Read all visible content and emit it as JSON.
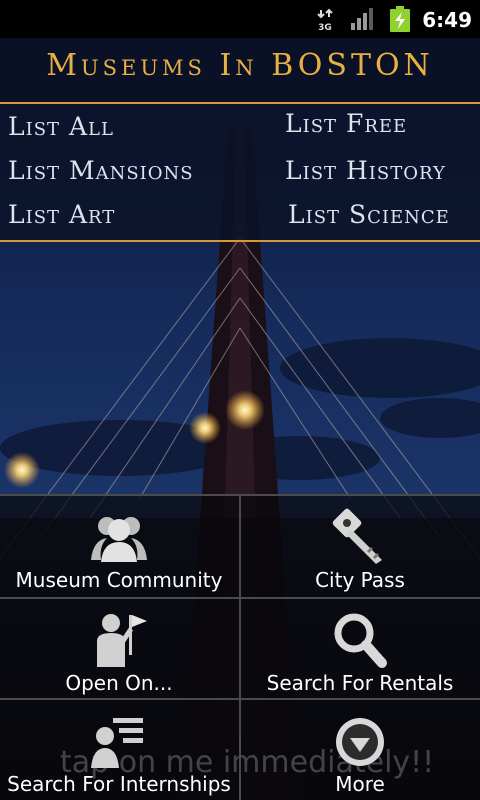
{
  "status_bar": {
    "network_type": "3G",
    "time": "6:49",
    "icons": [
      "network-3g-icon",
      "signal-strength-icon",
      "battery-charging-icon"
    ],
    "battery_color": "#8fd12e"
  },
  "header": {
    "title": "Museums In BOSTON",
    "accent_color": "#e8b040",
    "rule_color": "#d49a3a"
  },
  "list_links": [
    {
      "label": "List All"
    },
    {
      "label": "List Free"
    },
    {
      "label": "List Mansions"
    },
    {
      "label": "List History"
    },
    {
      "label": "List Art"
    },
    {
      "label": "List Science"
    }
  ],
  "dashboard": [
    {
      "label": "Museum Community",
      "icon": "people-group-icon"
    },
    {
      "label": "City Pass",
      "icon": "key-icon"
    },
    {
      "label": "Open On...",
      "icon": "person-flag-icon"
    },
    {
      "label": "Search For Rentals",
      "icon": "magnifier-icon"
    },
    {
      "label": "Search For Internships",
      "icon": "person-list-icon"
    },
    {
      "label": "More",
      "icon": "chevron-down-circle-icon"
    }
  ],
  "ad_banner": {
    "text": "tap on me immediately!!"
  }
}
